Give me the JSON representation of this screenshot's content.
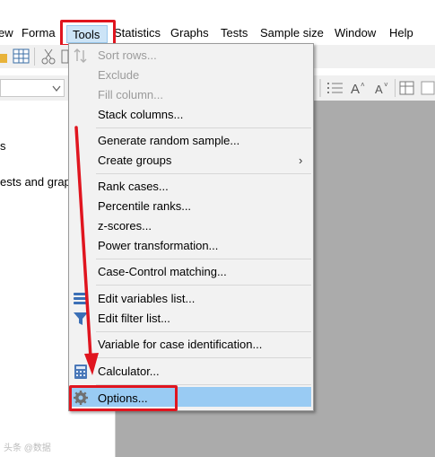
{
  "menubar": {
    "items": [
      "ew",
      "Forma",
      "Tools",
      "Statistics",
      "Graphs",
      "Tests",
      "Sample size",
      "Window",
      "Help"
    ]
  },
  "left_pane": {
    "lines": [
      "s",
      "ests and grap"
    ]
  },
  "tools_menu": {
    "items": [
      {
        "label": "Sort rows...",
        "enabled": false,
        "icon": "sort-icon"
      },
      {
        "label": "Exclude",
        "enabled": false
      },
      {
        "label": "Fill column...",
        "enabled": false
      },
      {
        "label": "Stack columns...",
        "enabled": true
      },
      {
        "label": "Generate random sample...",
        "enabled": true
      },
      {
        "label": "Create groups",
        "enabled": true,
        "submenu": "›"
      },
      {
        "label": "Rank cases...",
        "enabled": true
      },
      {
        "label": "Percentile ranks...",
        "enabled": true
      },
      {
        "label": "z-scores...",
        "enabled": true
      },
      {
        "label": "Power transformation...",
        "enabled": true
      },
      {
        "label": "Case-Control matching...",
        "enabled": true
      },
      {
        "label": "Edit variables list...",
        "enabled": true,
        "icon": "layers-icon"
      },
      {
        "label": "Edit filter list...",
        "enabled": true,
        "icon": "filter-icon"
      },
      {
        "label": "Variable for case identification...",
        "enabled": true
      },
      {
        "label": "Calculator...",
        "enabled": true,
        "icon": "calculator-icon"
      },
      {
        "label": "Options...",
        "enabled": true,
        "icon": "gear-icon",
        "highlighted": true
      }
    ]
  },
  "annotation": {
    "highlight_color": "#e0151f",
    "arrow_color": "#e0151f"
  },
  "watermark": "头条 @数据"
}
